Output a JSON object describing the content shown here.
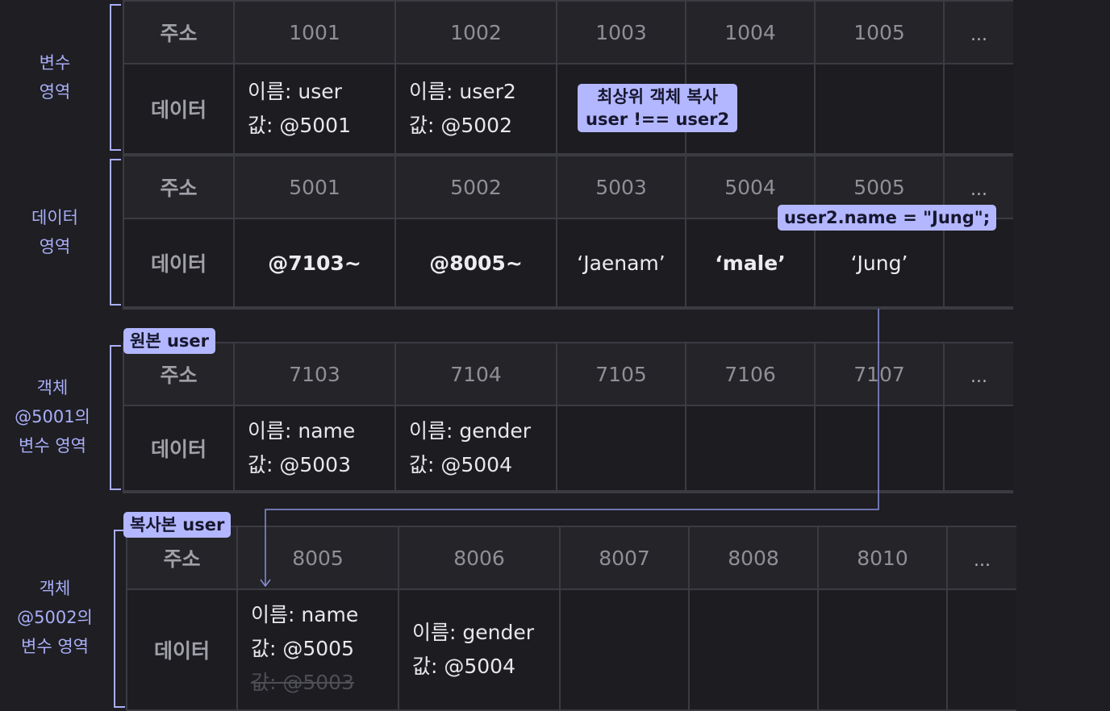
{
  "sections": [
    {
      "side_label": [
        "변수",
        "영역"
      ],
      "row_label_addr": "주소",
      "row_label_data": "데이터",
      "addresses": [
        "1001",
        "1002",
        "1003",
        "1004",
        "1005",
        "..."
      ],
      "data": [
        [
          "이름: user",
          "값: @5001"
        ],
        [
          "이름: user2",
          "값: @5002"
        ],
        [],
        [],
        [],
        []
      ]
    },
    {
      "side_label": [
        "데이터",
        "영역"
      ],
      "row_label_addr": "주소",
      "row_label_data": "데이터",
      "addresses": [
        "5001",
        "5002",
        "5003",
        "5004",
        "5005",
        "..."
      ],
      "data": [
        "@7103~",
        "@8005~",
        "‘Jaenam’",
        "‘male’",
        "‘Jung’",
        ""
      ]
    },
    {
      "side_label": [
        "객체",
        "@5001의",
        "변수 영역"
      ],
      "tag": "원본 user",
      "row_label_addr": "주소",
      "row_label_data": "데이터",
      "addresses": [
        "7103",
        "7104",
        "7105",
        "7106",
        "7107",
        "..."
      ],
      "data": [
        [
          "이름: name",
          "값: @5003"
        ],
        [
          "이름: gender",
          "값: @5004"
        ],
        [],
        [],
        [],
        []
      ]
    },
    {
      "side_label": [
        "객체",
        "@5002의",
        "변수 영역"
      ],
      "tag": "복사본 user",
      "row_label_addr": "주소",
      "row_label_data": "데이터",
      "addresses": [
        "8005",
        "8006",
        "8007",
        "8008",
        "8010",
        "..."
      ],
      "data": [
        [
          "이름: name",
          "값: @5005"
        ],
        [
          "이름: gender",
          "값: @5004"
        ],
        [],
        [],
        [],
        []
      ],
      "strikethrough": "값: @5003"
    }
  ],
  "annotations": {
    "copy_note_line1": "최상위 객체 복사",
    "copy_note_line2": "user  !==  user2",
    "assign_note": "user2.name = \"Jung\";"
  },
  "colors": {
    "background": "#1e1e23",
    "accent": "#a9aef7",
    "tag_bg": "#b3b7ff",
    "grid_line": "#3b3b42"
  }
}
